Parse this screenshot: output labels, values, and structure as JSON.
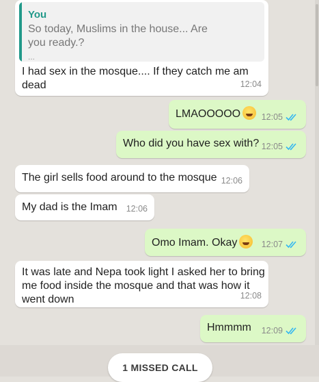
{
  "messages": [
    {
      "quote": {
        "author": "You",
        "text": "So today, Muslims in the house... Are you ready.?",
        "more": "..."
      },
      "line1": "I had sex in the mosque.... If they catch me am",
      "line2": "dead",
      "time": "12:04"
    },
    {
      "text": "LMAOOOOO",
      "emoji": "rolling-laughing-emoji",
      "time": "12:05",
      "status": "read"
    },
    {
      "text": "Who did you have sex with?",
      "time": "12:05",
      "status": "read"
    },
    {
      "text": "The girl sells food around to the mosque",
      "time": "12:06"
    },
    {
      "text": "My dad is the Imam",
      "time": "12:06"
    },
    {
      "text": "Omo Imam. Okay",
      "emoji": "laughing-emoji",
      "time": "12:07",
      "status": "read"
    },
    {
      "line1": "It was late and Nepa took light I asked her to bring",
      "line2": "me food inside the mosque and that was how it",
      "line3": "went down",
      "time": "12:08"
    },
    {
      "text": "Hmmmm",
      "time": "12:09",
      "status": "read"
    }
  ],
  "missed_call": {
    "label": "1 MISSED CALL"
  },
  "colors": {
    "background": "#e4e1dc",
    "incoming": "#ffffff",
    "outgoing": "#dcf8c6",
    "quote_accent": "#22998a",
    "read_ticks": "#34b7f1"
  }
}
